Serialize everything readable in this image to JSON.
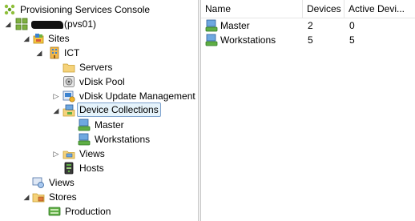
{
  "tree": {
    "root": {
      "label": "Provisioning Services Console"
    },
    "server": {
      "label_suffix": "(pvs01)"
    },
    "sites": {
      "label": "Sites"
    },
    "site_ict": {
      "label": "ICT"
    },
    "servers": {
      "label": "Servers"
    },
    "vdisk_pool": {
      "label": "vDisk Pool"
    },
    "vdisk_update": {
      "label": "vDisk Update Management"
    },
    "device_collections": {
      "label": "Device Collections"
    },
    "collection_master": {
      "label": "Master"
    },
    "collection_workstations": {
      "label": "Workstations"
    },
    "site_views": {
      "label": "Views"
    },
    "hosts": {
      "label": "Hosts"
    },
    "farm_views": {
      "label": "Views"
    },
    "stores": {
      "label": "Stores"
    },
    "production": {
      "label": "Production"
    }
  },
  "list": {
    "columns": {
      "name": "Name",
      "devices": "Devices",
      "active": "Active Devi..."
    },
    "rows": [
      {
        "name": "Master",
        "devices": "2",
        "active": "0"
      },
      {
        "name": "Workstations",
        "devices": "5",
        "active": "5"
      }
    ]
  }
}
